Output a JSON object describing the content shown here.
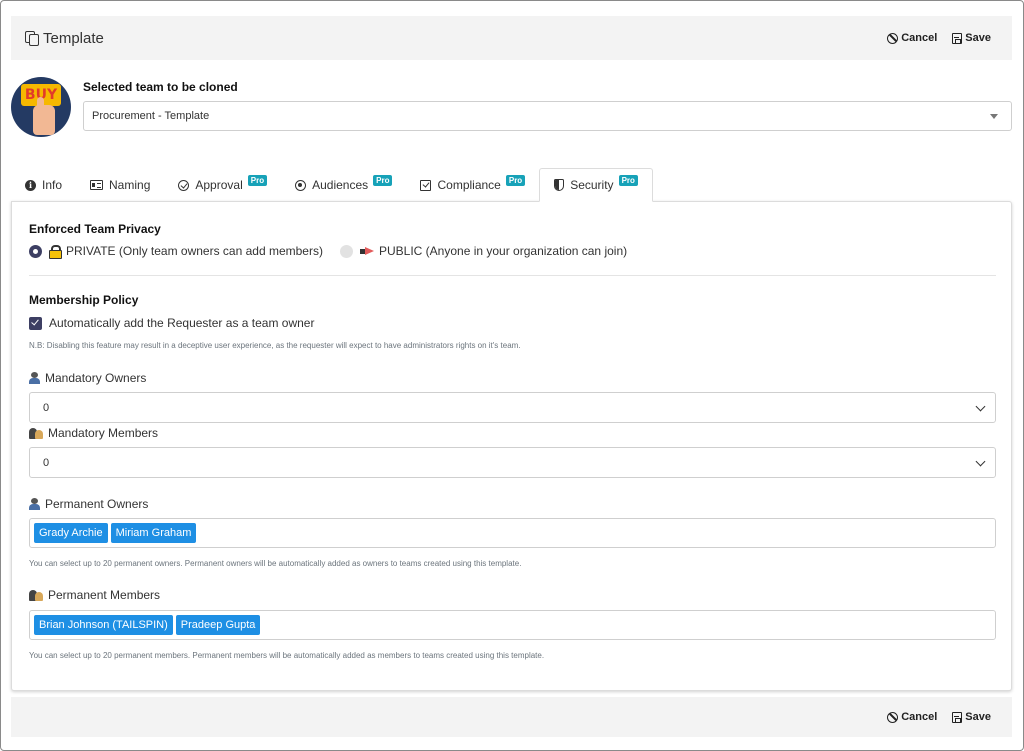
{
  "header": {
    "title": "Template",
    "cancel_label": "Cancel",
    "save_label": "Save"
  },
  "team_select": {
    "label": "Selected team to be cloned",
    "value": "Procurement - Template"
  },
  "logo": {
    "text": "BUY"
  },
  "tabs": [
    {
      "label": "Info",
      "icon": "info-icon",
      "pro": ""
    },
    {
      "label": "Naming",
      "icon": "id-card-icon",
      "pro": ""
    },
    {
      "label": "Approval",
      "icon": "check-circle-icon",
      "pro": "Pro"
    },
    {
      "label": "Audiences",
      "icon": "target-icon",
      "pro": "Pro"
    },
    {
      "label": "Compliance",
      "icon": "check-square-icon",
      "pro": "Pro"
    },
    {
      "label": "Security",
      "icon": "shield-icon",
      "pro": "Pro",
      "active": true
    }
  ],
  "privacy": {
    "title": "Enforced Team Privacy",
    "private_label": "PRIVATE (Only team owners can add members)",
    "public_label": "PUBLIC (Anyone in your organization can join)",
    "selected": "private"
  },
  "membership": {
    "title": "Membership Policy",
    "auto_add_label": "Automatically add the Requester as a team owner",
    "auto_add_checked": true,
    "note": "N.B: Disabling this feature may result in a deceptive user experience, as the requester will expect to have administrators rights on it's team."
  },
  "mandatory_owners": {
    "label": "Mandatory Owners",
    "value": "0"
  },
  "mandatory_members": {
    "label": "Mandatory Members",
    "value": "0"
  },
  "permanent_owners": {
    "label": "Permanent Owners",
    "chips": [
      "Grady Archie",
      "Miriam Graham"
    ],
    "help": "You can select up to 20 permanent owners. Permanent owners will be automatically added as owners to teams created using this template."
  },
  "permanent_members": {
    "label": "Permanent Members",
    "chips": [
      "Brian Johnson (TAILSPIN)",
      "Pradeep Gupta"
    ],
    "help": "You can select up to 20 permanent members. Permanent members will be automatically added as members to teams created using this template."
  },
  "footer": {
    "cancel_label": "Cancel",
    "save_label": "Save"
  },
  "colors": {
    "accent": "#3d3f63",
    "chip": "#1e8fe4",
    "pro_badge": "#17a2b8"
  }
}
